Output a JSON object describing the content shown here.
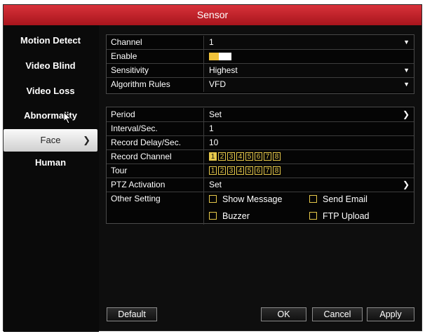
{
  "window": {
    "title": "Sensor"
  },
  "sidebar": {
    "items": [
      {
        "label": "Motion Detect"
      },
      {
        "label": "Video Blind"
      },
      {
        "label": "Video Loss"
      },
      {
        "label": "Abnormality"
      },
      {
        "label": "Face",
        "active": true
      },
      {
        "label": "Human"
      }
    ]
  },
  "top_panel": {
    "channel": {
      "label": "Channel",
      "value": "1"
    },
    "enable": {
      "label": "Enable",
      "state": "on"
    },
    "sensitivity": {
      "label": "Sensitivity",
      "value": "Highest"
    },
    "algorithm": {
      "label": "Algorithm Rules",
      "value": "VFD"
    }
  },
  "settings": {
    "period": {
      "label": "Period",
      "value": "Set"
    },
    "interval": {
      "label": "Interval/Sec.",
      "value": "1"
    },
    "record_delay": {
      "label": "Record Delay/Sec.",
      "value": "10"
    },
    "record_channel": {
      "label": "Record Channel",
      "channels": [
        "1",
        "2",
        "3",
        "4",
        "5",
        "6",
        "7",
        "8"
      ],
      "selected": [
        "1"
      ]
    },
    "tour": {
      "label": "Tour",
      "channels": [
        "1",
        "2",
        "3",
        "4",
        "5",
        "6",
        "7",
        "8"
      ],
      "selected": []
    },
    "ptz": {
      "label": "PTZ Activation",
      "value": "Set"
    },
    "other": {
      "label": "Other Setting",
      "options": {
        "show_message": "Show Message",
        "send_email": "Send Email",
        "buzzer": "Buzzer",
        "ftp_upload": "FTP Upload"
      }
    }
  },
  "buttons": {
    "default": "Default",
    "ok": "OK",
    "cancel": "Cancel",
    "apply": "Apply"
  },
  "colors": {
    "title_bar": "#c0202a",
    "accent": "#e6c84a",
    "background": "#0e0e0e"
  }
}
